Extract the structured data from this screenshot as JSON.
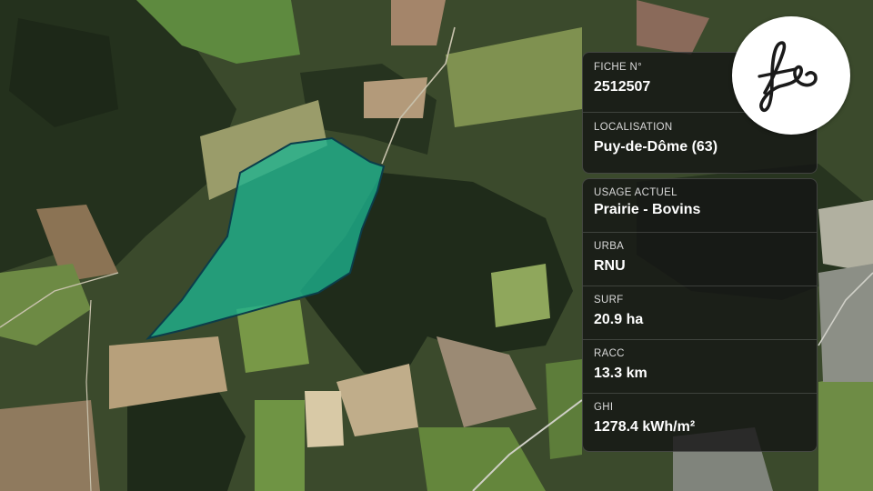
{
  "fiche": {
    "label": "FICHE N°",
    "value": "2512507"
  },
  "localisation": {
    "label": "LOCALISATION",
    "value": "Puy-de-Dôme (63)"
  },
  "details": [
    {
      "label": "USAGE ACTUEL",
      "value": "Prairie - Bovins"
    },
    {
      "label": "URBA",
      "value": "RNU"
    },
    {
      "label": "SURF",
      "value": "20.9 ha"
    },
    {
      "label": "RACC",
      "value": "13.3 km"
    },
    {
      "label": "GHI",
      "value": "1278.4 kWh/m²"
    }
  ],
  "logo": {
    "name": "fs-logo-icon"
  },
  "colors": {
    "parcel_fill": "#1db48f",
    "parcel_stroke": "#0b3d4a",
    "card_bg": "#141414"
  }
}
